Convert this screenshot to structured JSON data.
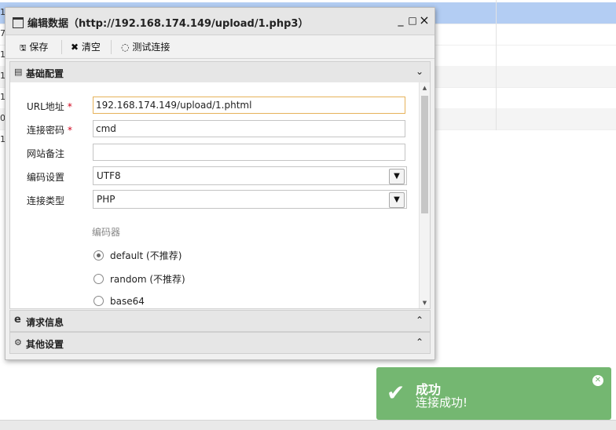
{
  "background": {
    "row_markers": [
      "1",
      "7",
      "1",
      "1",
      "1",
      "0",
      "1"
    ]
  },
  "dialog": {
    "title": "编辑数据（http://192.168.174.149/upload/1.php3）",
    "window_buttons": {
      "minimize": "_",
      "maximize": "□",
      "close": "×"
    },
    "toolbar": {
      "save": "保存",
      "clear": "清空",
      "test": "测试连接"
    },
    "sections": {
      "basic": "基础配置",
      "request": "请求信息",
      "other": "其他设置"
    },
    "form": {
      "url_label": "URL地址",
      "url_value": "192.168.174.149/upload/1.phtml",
      "password_label": "连接密码",
      "password_value": "cmd",
      "note_label": "网站备注",
      "note_value": "",
      "encoding_label": "编码设置",
      "encoding_value": "UTF8",
      "type_label": "连接类型",
      "type_value": "PHP",
      "required_mark": "*",
      "encoder_label": "编码器",
      "encoders": [
        {
          "label": "default (不推荐)",
          "selected": true
        },
        {
          "label": "random (不推荐)",
          "selected": false
        },
        {
          "label": "base64",
          "selected": false
        }
      ]
    }
  },
  "toast": {
    "title": "成功",
    "message": "连接成功!",
    "color": "#74b771"
  }
}
